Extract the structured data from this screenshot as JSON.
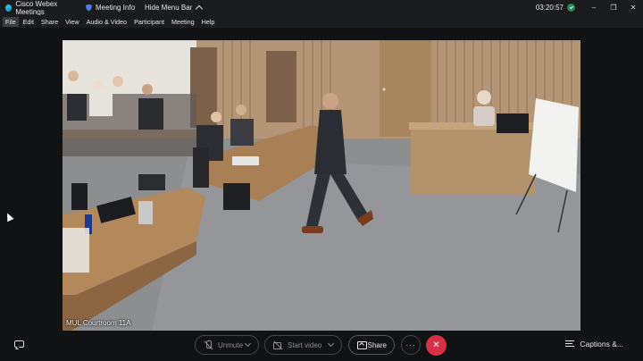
{
  "titlebar": {
    "app_title": "Cisco Webex Meetings",
    "meeting_info": "Meeting Info",
    "hide_menu_bar": "Hide Menu Bar",
    "clock": "03:20:57",
    "minimize": "–",
    "maximize": "❐",
    "close": "✕"
  },
  "menubar": {
    "items": [
      {
        "label": "File"
      },
      {
        "label": "Edit"
      },
      {
        "label": "Share"
      },
      {
        "label": "View"
      },
      {
        "label": "Audio & Video"
      },
      {
        "label": "Participant"
      },
      {
        "label": "Meeting"
      },
      {
        "label": "Help"
      }
    ]
  },
  "video": {
    "participant_label": "MUL Courtroom 11A"
  },
  "controls": {
    "unmute_label": "Unmute",
    "start_video_label": "Start video",
    "share_label": "Share",
    "more_label": "···",
    "end_label": "✕",
    "captions_label": "Captions &..."
  },
  "colors": {
    "end_button": "#d9304a",
    "background": "#111214",
    "status_dot": "#1e8f4e"
  }
}
